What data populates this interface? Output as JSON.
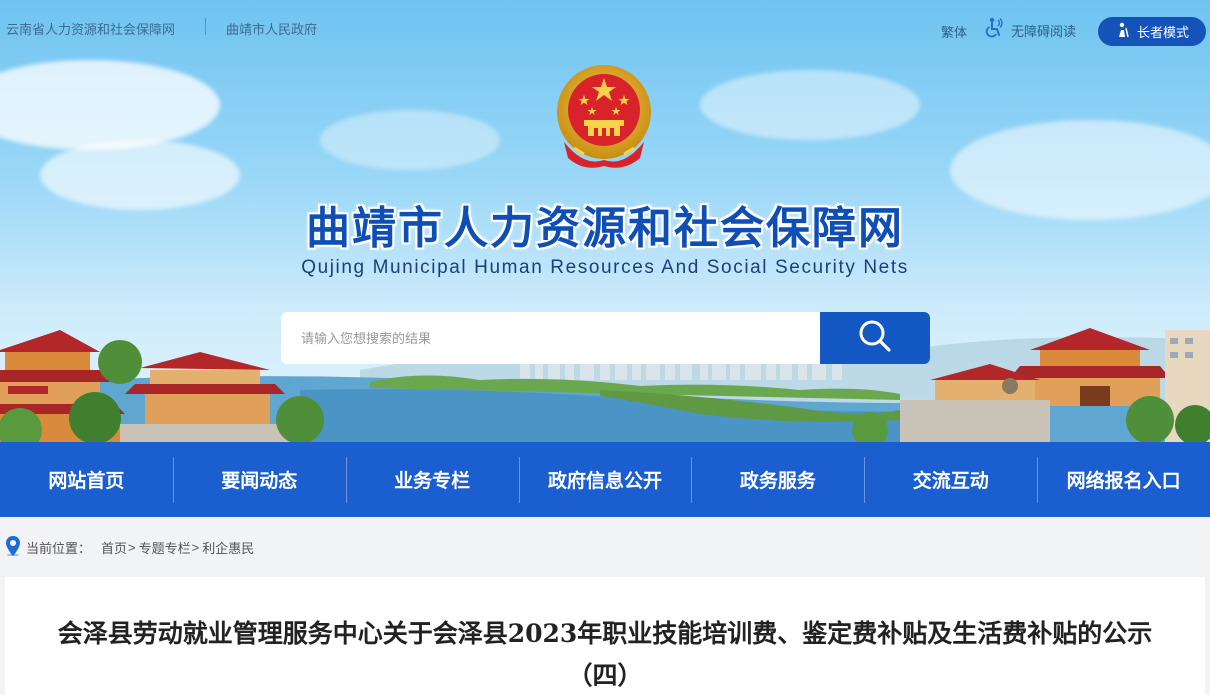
{
  "topbar": {
    "link_province": "云南省人力资源和社会保障网",
    "link_city": "曲靖市人民政府",
    "traditional": "繁体",
    "accessibility": "无障碍阅读",
    "elder_mode": "长者模式"
  },
  "header": {
    "title": "曲靖市人力资源和社会保障网",
    "subtitle": "Qujing Municipal Human Resources And Social Security Nets"
  },
  "search": {
    "placeholder": "请输入您想搜索的结果"
  },
  "nav": {
    "items": [
      {
        "label": "网站首页"
      },
      {
        "label": "要闻动态"
      },
      {
        "label": "业务专栏"
      },
      {
        "label": "政府信息公开"
      },
      {
        "label": "政务服务"
      },
      {
        "label": "交流互动"
      },
      {
        "label": "网络报名入口"
      }
    ]
  },
  "breadcrumb": {
    "label": "当前位置：",
    "items": [
      "首页",
      "专题专栏",
      "利企惠民"
    ],
    "separator": ">"
  },
  "article": {
    "title": "会泽县劳动就业管理服务中心关于会泽县2023年职业技能培训费、鉴定费补贴及生活费补贴的公示（四）"
  },
  "colors": {
    "nav_bg": "#1a5ed0",
    "title_blue": "#0f4fb5",
    "search_btn": "#1458c4"
  }
}
